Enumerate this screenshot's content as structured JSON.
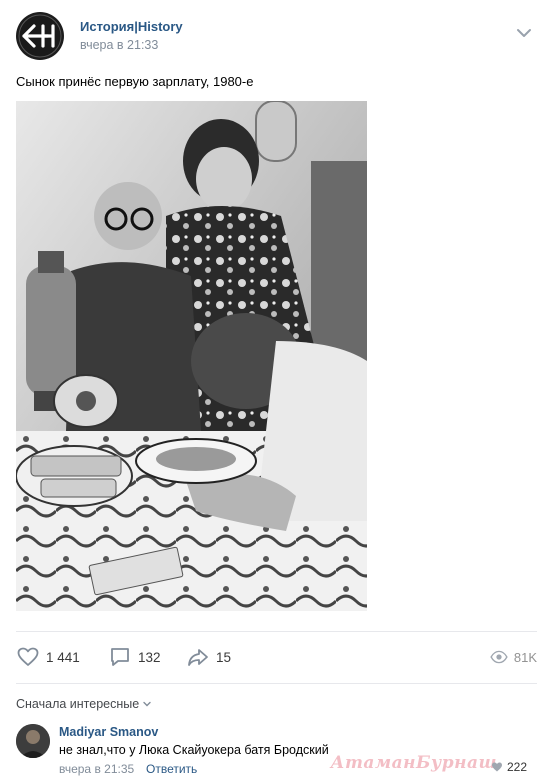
{
  "post": {
    "author": "История|History",
    "time": "вчера в 21:33",
    "text": "Сынок принёс первую зарплату, 1980-е",
    "avatar_icon": "arrow-left-h-logo-icon",
    "menu_icon": "chevron-down-icon"
  },
  "photo": {
    "icon": "black-and-white-photo"
  },
  "actions": {
    "likes": "1 441",
    "comments": "132",
    "shares": "15",
    "views": "81K"
  },
  "comments_section": {
    "sort_label": "Сначала интересные",
    "items": [
      {
        "author": "Madiyar Smanov",
        "text": "не знал,что у Люка Скайуокера батя Бродский",
        "time": "вчера в 21:35",
        "reply_label": "Ответить",
        "likes": "222"
      }
    ]
  },
  "watermark": "АтаманБурнаш",
  "colors": {
    "link": "#2a5885",
    "muted": "#818c99",
    "divider": "#e7e8ec"
  }
}
